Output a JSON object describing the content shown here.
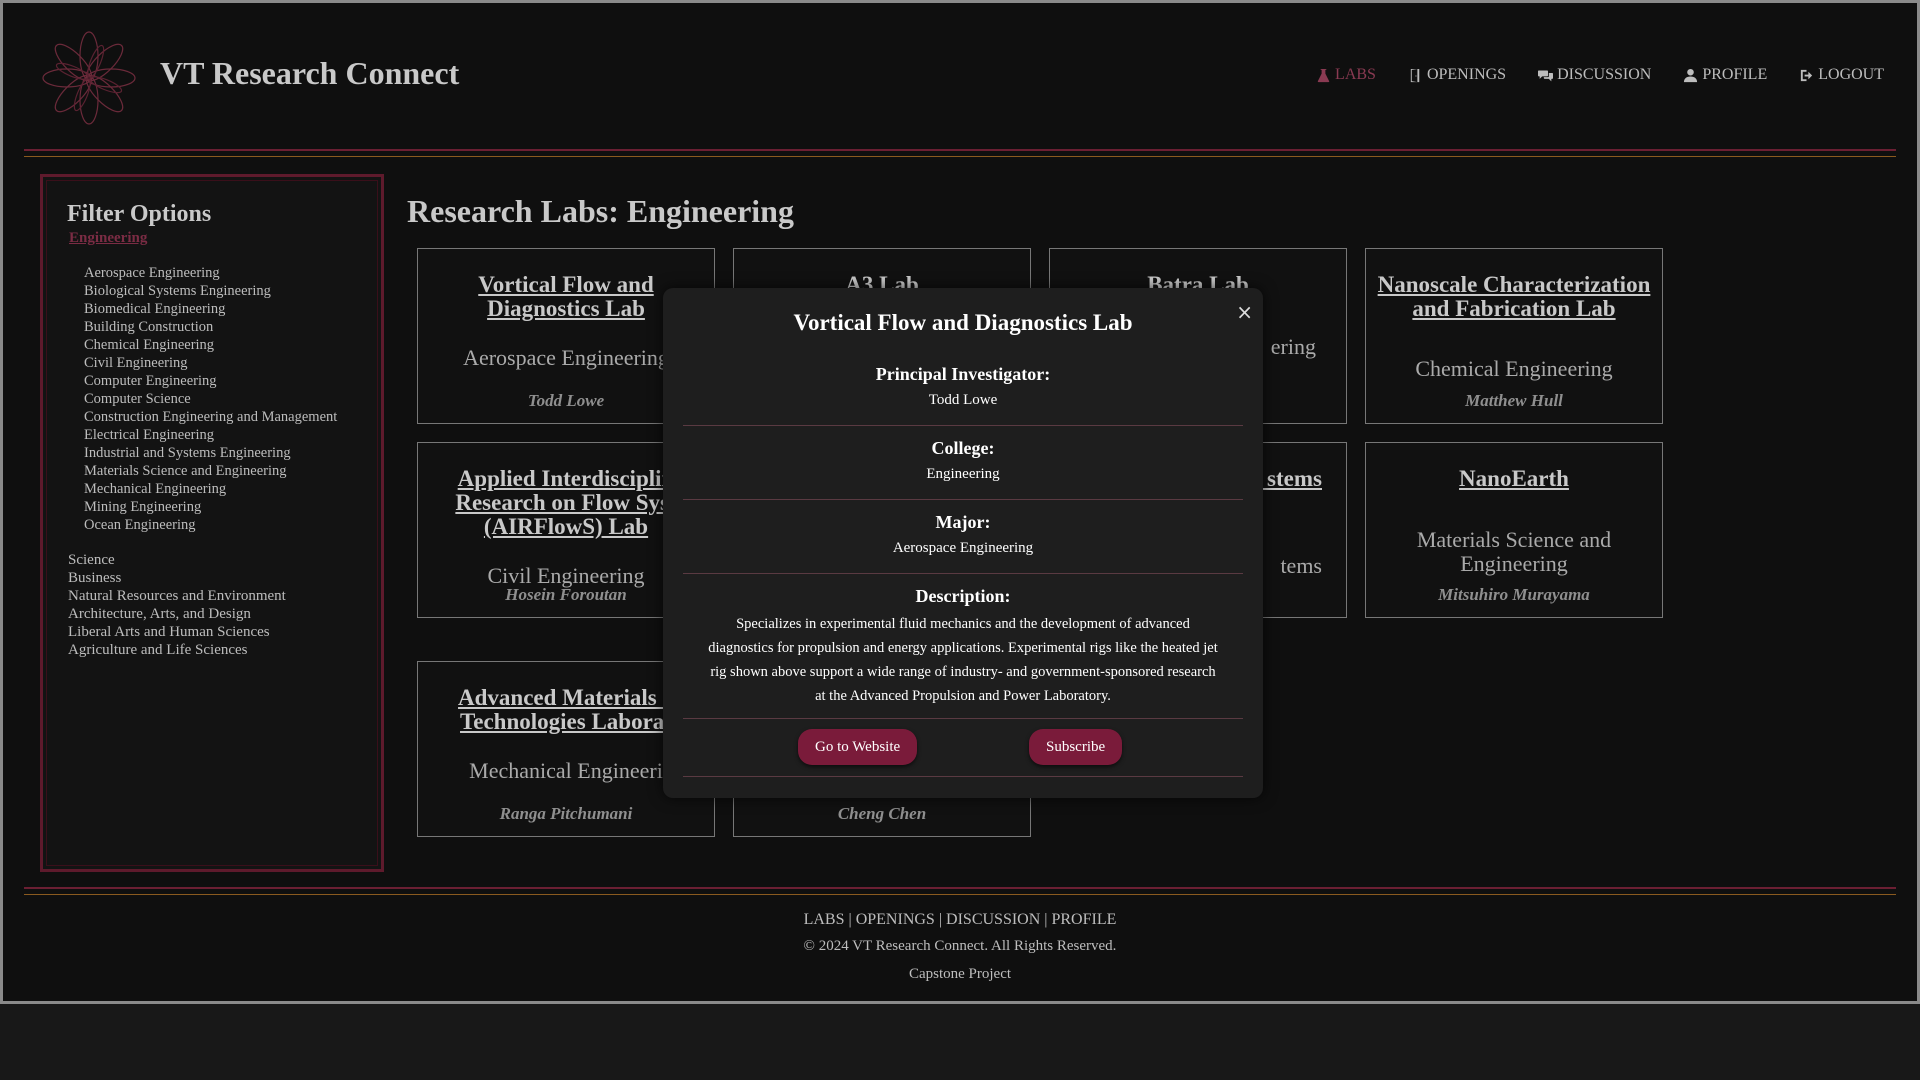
{
  "header": {
    "title": "VT Research Connect",
    "nav": [
      {
        "label": "LABS",
        "icon": "flask-icon",
        "active": true
      },
      {
        "label": "OPENINGS",
        "icon": "door-icon"
      },
      {
        "label": "DISCUSSION",
        "icon": "comments-icon"
      },
      {
        "label": "PROFILE",
        "icon": "user-icon"
      },
      {
        "label": "LOGOUT",
        "icon": "logout-icon"
      }
    ]
  },
  "sidebar": {
    "title": "Filter Options",
    "active_college": "Engineering",
    "subjects": [
      "Aerospace Engineering",
      "Biological Systems Engineering",
      "Biomedical Engineering",
      "Building Construction",
      "Chemical Engineering",
      "Civil Engineering",
      "Computer Engineering",
      "Computer Science",
      "Construction Engineering and Management",
      "Electrical Engineering",
      "Industrial and Systems Engineering",
      "Materials Science and Engineering",
      "Mechanical Engineering",
      "Mining Engineering",
      "Ocean Engineering"
    ],
    "colleges": [
      "Science",
      "Business",
      "Natural Resources and Environment",
      "Architecture, Arts, and Design",
      "Liberal Arts and Human Sciences",
      "Agriculture and Life Sciences"
    ]
  },
  "main": {
    "title": "Research Labs: Engineering",
    "labs": [
      {
        "name": "Vortical Flow and Diagnostics Lab",
        "dept": "Aerospace Engineering",
        "pi": "Todd Lowe"
      },
      {
        "name": "A3 Lab",
        "dept": "",
        "pi": ""
      },
      {
        "name": "Batra Lab",
        "dept": "ering",
        "pi": ""
      },
      {
        "name": "Nanoscale Characterization and Fabrication Lab",
        "dept": "Chemical Engineering",
        "pi": "Matthew Hull"
      },
      {
        "name": "Applied Interdisciplin Research on Flow Syst (AIRFlowS) Lab",
        "dept": "Civil Engineering",
        "pi": "Hosein Foroutan"
      },
      {
        "name": "",
        "dept": "",
        "pi": ""
      },
      {
        "name": "r stems",
        "dept": "tems",
        "pi": ""
      },
      {
        "name": "NanoEarth",
        "dept": "Materials Science and Engineering",
        "pi": "Mitsuhiro Murayama"
      },
      {
        "name": "Advanced Materials a Technologies Laborat",
        "dept": "Mechanical Engineeri",
        "pi": "Ranga Pitchumani"
      },
      {
        "name": "",
        "dept": "",
        "pi": "Cheng Chen"
      }
    ]
  },
  "modal": {
    "title": "Vortical Flow and Diagnostics Lab",
    "close": "×",
    "pi_label": "Principal Investigator:",
    "pi": "Todd Lowe",
    "college_label": "College:",
    "college": "Engineering",
    "major_label": "Major:",
    "major": "Aerospace Engineering",
    "description_label": "Description:",
    "description": "Specializes in experimental fluid mechanics and the development of advanced diagnostics for propulsion and energy applications. Experimental rigs like the heated jet rig shown above support a wide range of industry- and government-sponsored research at the Advanced Propulsion and Power Laboratory.",
    "website_button": "Go to Website",
    "subscribe_button": "Subscribe"
  },
  "footer": {
    "links": [
      "LABS",
      "OPENINGS",
      "DISCUSSION",
      "PROFILE"
    ],
    "separator": "|",
    "copyright": "© 2024 VT Research Connect. All Rights Reserved.",
    "note": "Capstone Project"
  },
  "colors": {
    "accent": "#7a1b3a",
    "active_nav": "#8a3a52",
    "background": "#0f0f0f",
    "divider_orange": "#8a5a1f"
  }
}
